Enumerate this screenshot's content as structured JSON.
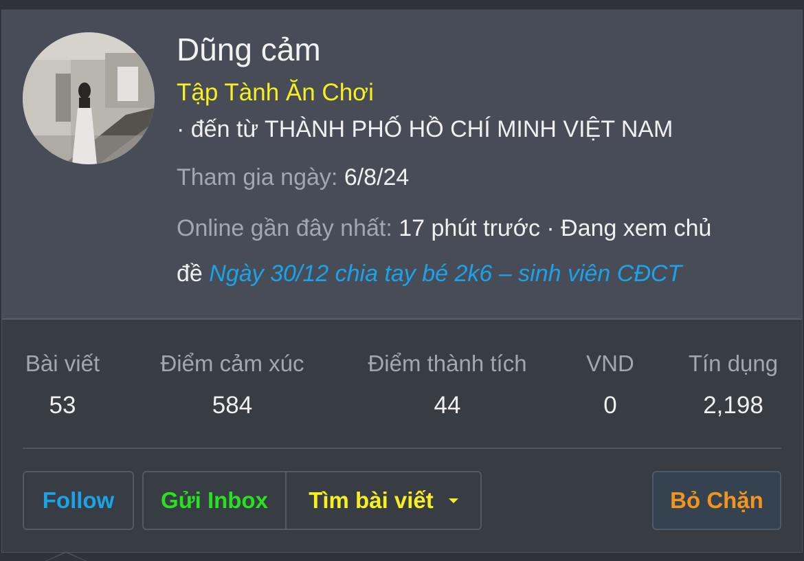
{
  "profile": {
    "name": "Dũng cảm",
    "title": "Tập Tành Ăn Chơi",
    "from": "· đến từ THÀNH PHỐ HỒ CHÍ MINH VIỆT NAM",
    "joined_label": "Tham gia ngày:",
    "joined_value": "6/8/24",
    "online_label": "Online gần đây nhất:",
    "online_value": "17 phút trước · Đang xem chủ",
    "viewing_prefix": "đề",
    "viewing_thread": "Ngày 30/12 chia tay bé 2k6 – sinh viên CĐCT"
  },
  "stats": [
    {
      "label": "Bài viết",
      "value": "53"
    },
    {
      "label": "Điểm cảm xúc",
      "value": "584"
    },
    {
      "label": "Điểm thành tích",
      "value": "44"
    },
    {
      "label": "VND",
      "value": "0"
    },
    {
      "label": "Tín dụng",
      "value": "2,198"
    }
  ],
  "actions": {
    "follow": "Follow",
    "inbox": "Gửi Inbox",
    "find_posts": "Tìm bài viết",
    "unblock": "Bỏ Chặn"
  },
  "colors": {
    "title": "#f7ef1f",
    "link": "#1aa3e8",
    "follow": "#1aa3e8",
    "inbox": "#29e21f",
    "find_posts": "#f7ef1f",
    "unblock": "#f5941d"
  }
}
